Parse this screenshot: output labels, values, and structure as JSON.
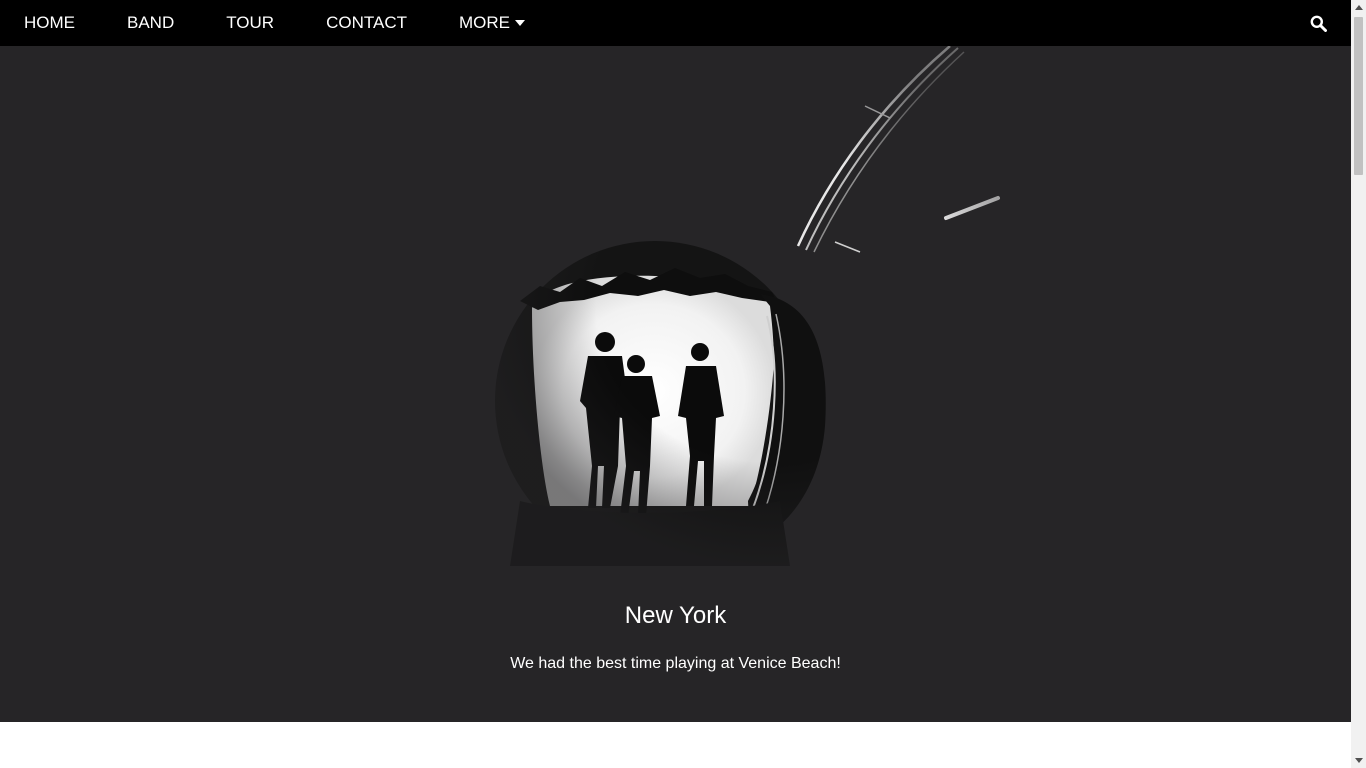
{
  "nav": {
    "items": [
      {
        "label": "HOME"
      },
      {
        "label": "BAND"
      },
      {
        "label": "TOUR"
      },
      {
        "label": "CONTACT"
      }
    ],
    "more_label": "MORE",
    "more_icon": "caret-down-icon",
    "search_icon": "search-icon"
  },
  "slide": {
    "title": "New York",
    "caption": "We had the best time playing at Venice Beach!"
  },
  "colors": {
    "navbar_bg": "#000000",
    "hero_bg": "#262527",
    "text": "#ffffff"
  }
}
